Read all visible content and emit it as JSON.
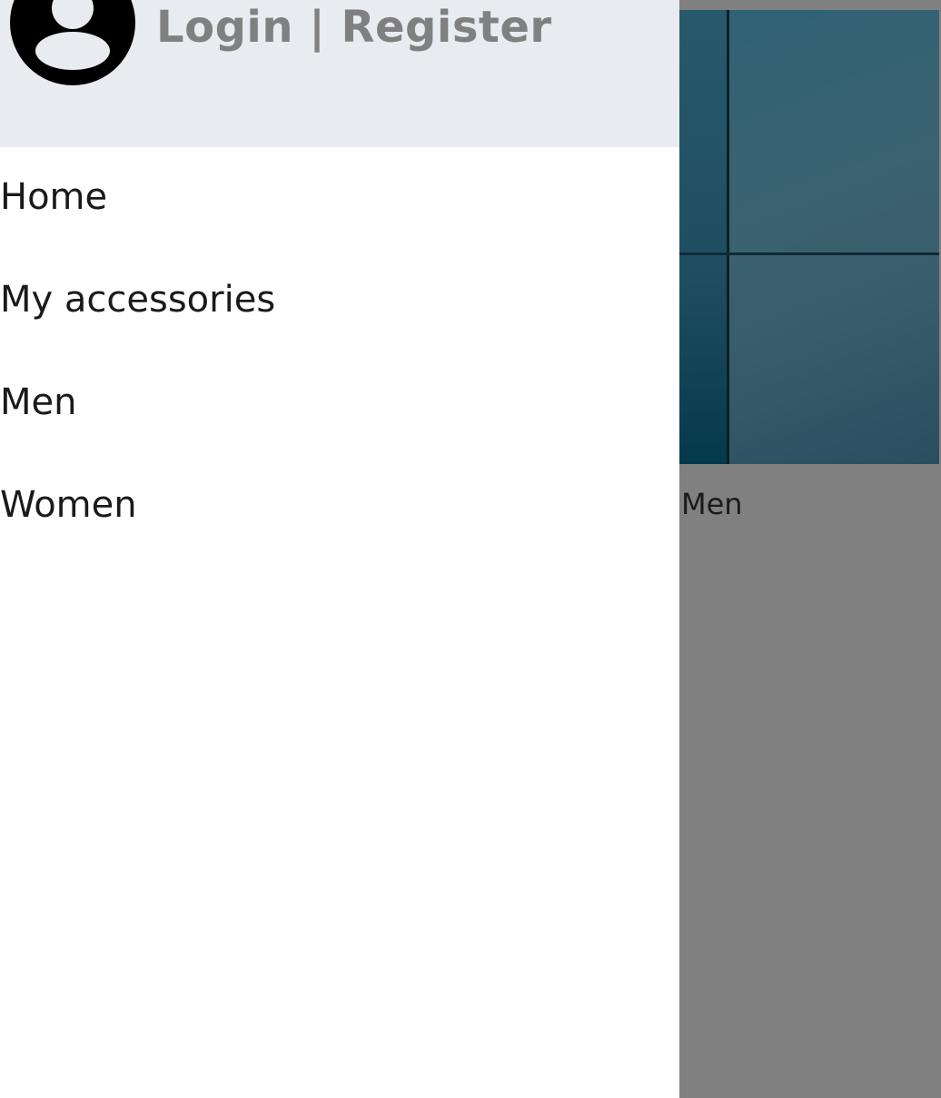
{
  "drawer": {
    "header": {
      "auth_link_label": "Login | Register",
      "avatar_icon": "account-circle-icon",
      "background": "#e8ebf0"
    },
    "nav_items": [
      {
        "label": "Home"
      },
      {
        "label": "My accessories"
      },
      {
        "label": "Men"
      },
      {
        "label": "Women"
      }
    ]
  },
  "background_page": {
    "category_card": {
      "caption": "Men"
    }
  },
  "colors": {
    "scrim": "#808080",
    "auth_link_text": "#808080",
    "nav_text": "#1a1a1a"
  }
}
